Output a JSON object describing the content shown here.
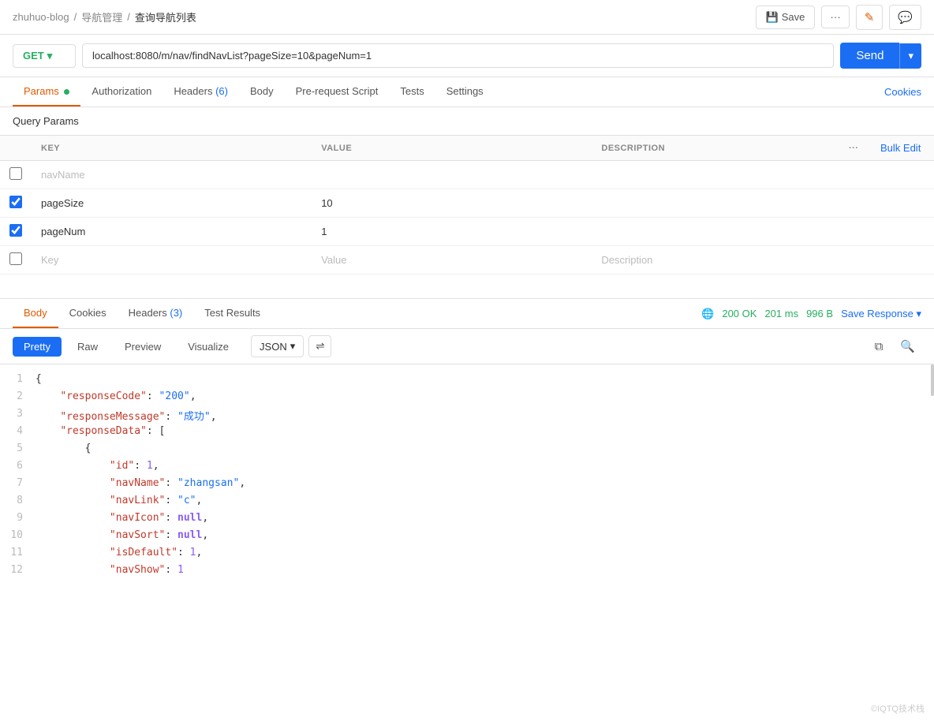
{
  "breadcrumb": {
    "items": [
      "zhuhuo-blog",
      "导航管理",
      "查询导航列表"
    ],
    "separators": [
      "/",
      "/"
    ]
  },
  "toolbar": {
    "save_label": "Save",
    "more_label": "···",
    "edit_icon": "✎",
    "comment_icon": "▯"
  },
  "url_bar": {
    "method": "GET",
    "url": "localhost:8080/m/nav/findNavList?pageSize=10&pageNum=1",
    "send_label": "Send"
  },
  "tabs": {
    "items": [
      {
        "label": "Params",
        "active": true,
        "dot": true
      },
      {
        "label": "Authorization",
        "active": false
      },
      {
        "label": "Headers",
        "active": false,
        "badge": "(6)"
      },
      {
        "label": "Body",
        "active": false
      },
      {
        "label": "Pre-request Script",
        "active": false
      },
      {
        "label": "Tests",
        "active": false
      },
      {
        "label": "Settings",
        "active": false
      }
    ],
    "cookies_label": "Cookies"
  },
  "query_params": {
    "section_title": "Query Params",
    "columns": {
      "key": "KEY",
      "value": "VALUE",
      "description": "DESCRIPTION",
      "bulk_edit": "Bulk Edit"
    },
    "rows": [
      {
        "checked": false,
        "key": "navName",
        "value": "",
        "description": ""
      },
      {
        "checked": true,
        "key": "pageSize",
        "value": "10",
        "description": ""
      },
      {
        "checked": true,
        "key": "pageNum",
        "value": "1",
        "description": ""
      },
      {
        "checked": false,
        "key": "",
        "value": "",
        "description": ""
      }
    ],
    "placeholders": {
      "key": "Key",
      "value": "Value",
      "description": "Description"
    }
  },
  "response": {
    "tabs": [
      {
        "label": "Body",
        "active": true
      },
      {
        "label": "Cookies",
        "active": false
      },
      {
        "label": "Headers",
        "active": false,
        "badge": "(3)"
      },
      {
        "label": "Test Results",
        "active": false
      }
    ],
    "status": "200 OK",
    "time": "201 ms",
    "size": "996 B",
    "save_response_label": "Save Response",
    "view_modes": [
      "Pretty",
      "Raw",
      "Preview",
      "Visualize"
    ],
    "active_view": "Pretty",
    "format": "JSON",
    "code_lines": [
      {
        "num": 1,
        "content": "{"
      },
      {
        "num": 2,
        "content": "    \"responseCode\": \"200\","
      },
      {
        "num": 3,
        "content": "    \"responseMessage\": \"成功\","
      },
      {
        "num": 4,
        "content": "    \"responseData\": ["
      },
      {
        "num": 5,
        "content": "        {"
      },
      {
        "num": 6,
        "content": "            \"id\": 1,"
      },
      {
        "num": 7,
        "content": "            \"navName\": \"zhangsan\","
      },
      {
        "num": 8,
        "content": "            \"navLink\": \"c\","
      },
      {
        "num": 9,
        "content": "            \"navIcon\": null,"
      },
      {
        "num": 10,
        "content": "            \"navSort\": null,"
      },
      {
        "num": 11,
        "content": "            \"isDefault\": 1,"
      },
      {
        "num": 12,
        "content": "            \"navShow\": 1"
      }
    ]
  }
}
